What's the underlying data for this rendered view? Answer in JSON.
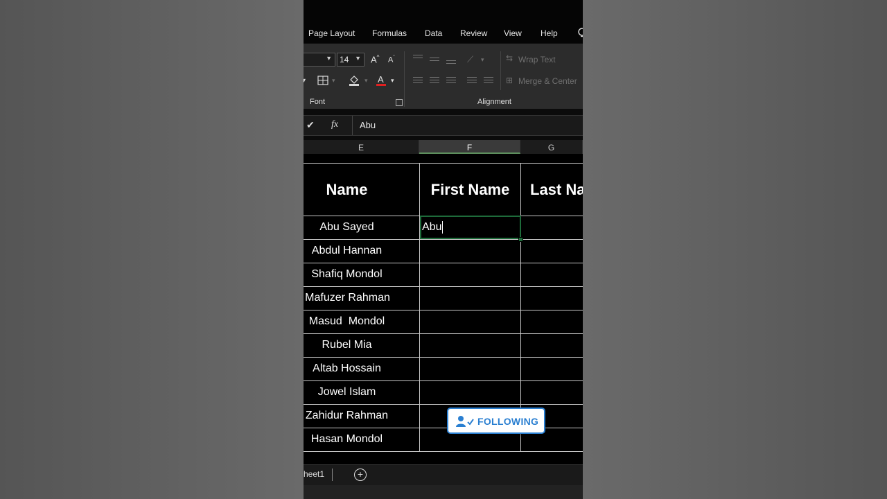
{
  "menu": {
    "items": [
      "Page Layout",
      "Formulas",
      "Data",
      "Review",
      "View",
      "Help"
    ]
  },
  "ribbon": {
    "font_size": "14",
    "font_group_label": "Font",
    "alignment_group_label": "Alignment",
    "wrap_text_label": "Wrap Text",
    "merge_center_label": "Merge & Center",
    "grow_font_icon": "A^",
    "shrink_font_icon": "A",
    "font_color": "#e02020"
  },
  "formula_bar": {
    "fx_label": "fx",
    "value": "Abu"
  },
  "columns": {
    "e": "E",
    "f": "F",
    "g": "G"
  },
  "table": {
    "headers": [
      "Name",
      "First Name",
      "Last Na"
    ],
    "rows": [
      "Abu Sayed",
      "Abdul Hannan",
      "Shafiq Mondol",
      "Mafuzer Rahman",
      "Masud  Mondol",
      "Rubel Mia",
      "Altab Hossain",
      "Jowel Islam",
      "Zahidur Rahman",
      "Hasan Mondol"
    ],
    "editing_value": "Abu"
  },
  "follow_button": {
    "label": "FOLLOWING",
    "color": "#2a7fd1"
  },
  "sheets": {
    "tab_label": "heet1",
    "add_symbol": "+"
  }
}
